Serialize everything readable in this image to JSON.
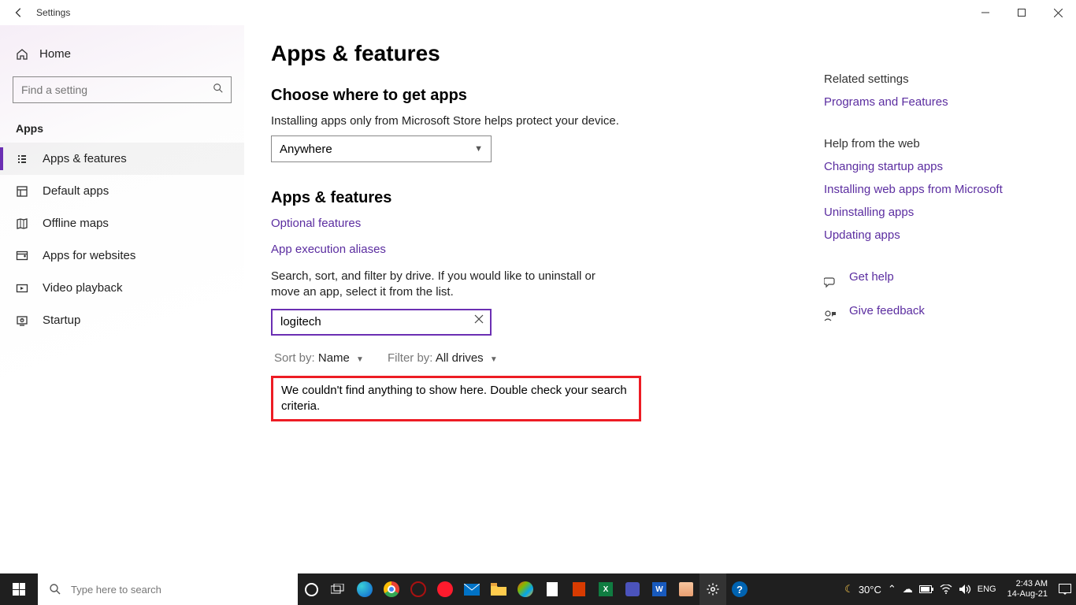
{
  "window": {
    "title": "Settings"
  },
  "sidebar": {
    "home": "Home",
    "search_placeholder": "Find a setting",
    "section": "Apps",
    "items": [
      {
        "icon": "list-icon",
        "label": "Apps & features",
        "selected": true
      },
      {
        "icon": "defaults-icon",
        "label": "Default apps",
        "selected": false
      },
      {
        "icon": "map-icon",
        "label": "Offline maps",
        "selected": false
      },
      {
        "icon": "websites-icon",
        "label": "Apps for websites",
        "selected": false
      },
      {
        "icon": "video-icon",
        "label": "Video playback",
        "selected": false
      },
      {
        "icon": "startup-icon",
        "label": "Startup",
        "selected": false
      }
    ]
  },
  "page": {
    "title": "Apps & features",
    "choose_heading": "Choose where to get apps",
    "choose_sub": "Installing apps only from Microsoft Store helps protect your device.",
    "source_value": "Anywhere",
    "af_heading": "Apps & features",
    "link_optional": "Optional features",
    "link_aliases": "App execution aliases",
    "search_desc": "Search, sort, and filter by drive. If you would like to uninstall or move an app, select it from the list.",
    "app_search_value": "logitech",
    "sort_label": "Sort by:",
    "sort_value": "Name",
    "filter_label": "Filter by:",
    "filter_value": "All drives",
    "empty_msg": "We couldn't find anything to show here. Double check your search criteria."
  },
  "rail": {
    "related_h": "Related settings",
    "related_link": "Programs and Features",
    "web_h": "Help from the web",
    "web_links": [
      "Changing startup apps",
      "Installing web apps from Microsoft",
      "Uninstalling apps",
      "Updating apps"
    ],
    "get_help": "Get help",
    "give_feedback": "Give feedback"
  },
  "taskbar": {
    "search_placeholder": "Type here to search",
    "weather_temp": "30°C",
    "time": "2:43 AM",
    "date": "14-Aug-21"
  }
}
